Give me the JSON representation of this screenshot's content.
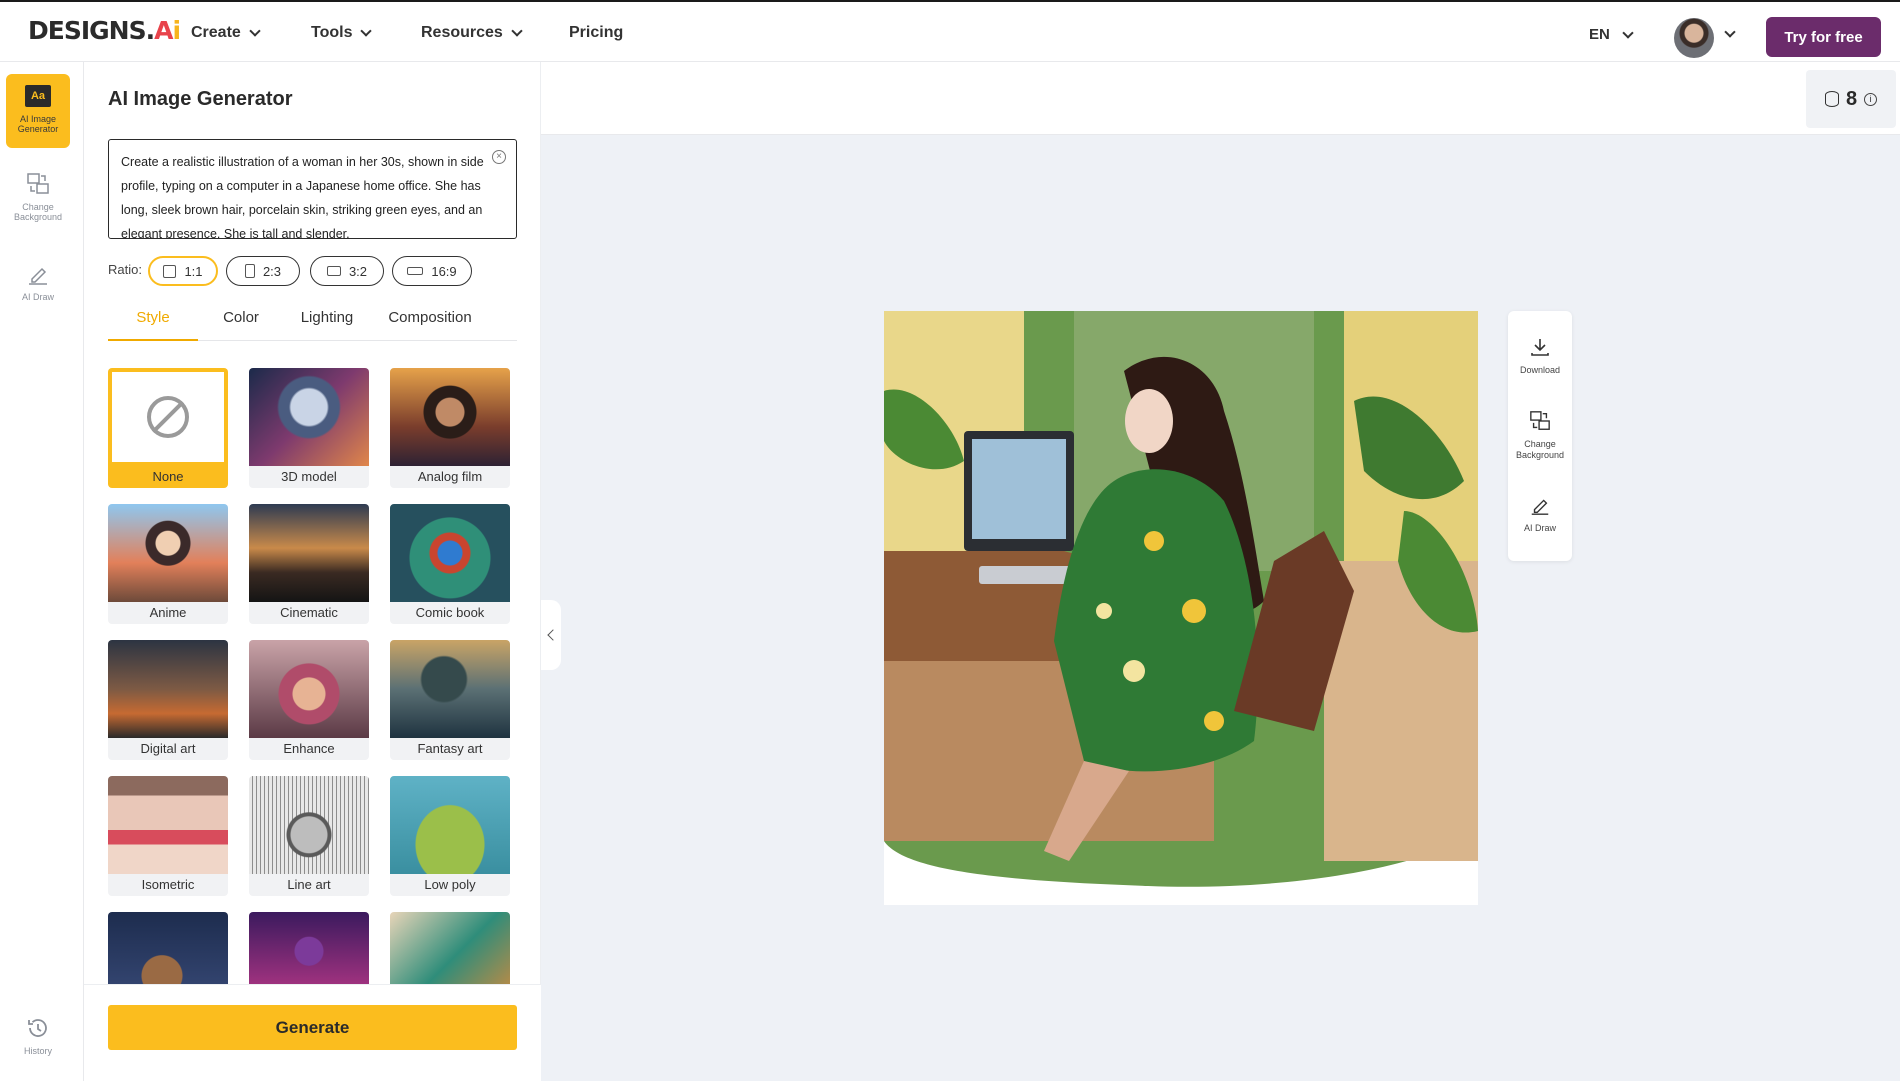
{
  "brand": {
    "logo_main": "DESIGNS.",
    "logo_a": "A",
    "logo_i": "i"
  },
  "nav": [
    {
      "label": "Create",
      "has_menu": true
    },
    {
      "label": "Tools",
      "has_menu": true
    },
    {
      "label": "Resources",
      "has_menu": true
    },
    {
      "label": "Pricing",
      "has_menu": false
    }
  ],
  "header": {
    "language": "EN",
    "try_button": "Try for free"
  },
  "rail": {
    "items": [
      {
        "label": "AI Image Generator",
        "icon": "aa-icon",
        "active": true
      },
      {
        "label": "Change Background",
        "icon": "change-background-icon",
        "active": false
      },
      {
        "label": "AI Draw",
        "icon": "pen-icon",
        "active": false
      }
    ],
    "history_label": "History"
  },
  "panel": {
    "title": "AI Image Generator",
    "prompt_text": "Create a realistic illustration of a woman in her 30s, shown in side profile, typing on a computer in a Japanese home office. She has long, sleek brown hair, porcelain skin, striking green eyes, and an elegant presence. She is tall and slender,",
    "ratio_label": "Ratio:",
    "ratios": [
      {
        "label": "1:1",
        "active": true
      },
      {
        "label": "2:3",
        "active": false
      },
      {
        "label": "3:2",
        "active": false
      },
      {
        "label": "16:9",
        "active": false
      }
    ],
    "tabs": [
      {
        "label": "Style",
        "active": true
      },
      {
        "label": "Color",
        "active": false
      },
      {
        "label": "Lighting",
        "active": false
      },
      {
        "label": "Composition",
        "active": false
      }
    ],
    "styles": [
      {
        "label": "None",
        "selected": true
      },
      {
        "label": "3D model",
        "selected": false
      },
      {
        "label": "Analog film",
        "selected": false
      },
      {
        "label": "Anime",
        "selected": false
      },
      {
        "label": "Cinematic",
        "selected": false
      },
      {
        "label": "Comic book",
        "selected": false
      },
      {
        "label": "Digital art",
        "selected": false
      },
      {
        "label": "Enhance",
        "selected": false
      },
      {
        "label": "Fantasy art",
        "selected": false
      },
      {
        "label": "Isometric",
        "selected": false
      },
      {
        "label": "Line art",
        "selected": false
      },
      {
        "label": "Low poly",
        "selected": false
      },
      {
        "label": "",
        "selected": false
      },
      {
        "label": "",
        "selected": false
      },
      {
        "label": "",
        "selected": false
      }
    ],
    "generate_button": "Generate"
  },
  "canvas": {
    "credits": "8",
    "tools": [
      {
        "label": "Download",
        "icon": "download-icon"
      },
      {
        "label": "Change Background",
        "icon": "change-background-icon"
      },
      {
        "label": "AI Draw",
        "icon": "pen-icon"
      }
    ]
  },
  "colors": {
    "accent": "#fbbd1e",
    "brand_button": "#6b2c6b",
    "canvas_bg": "#eef1f6"
  }
}
